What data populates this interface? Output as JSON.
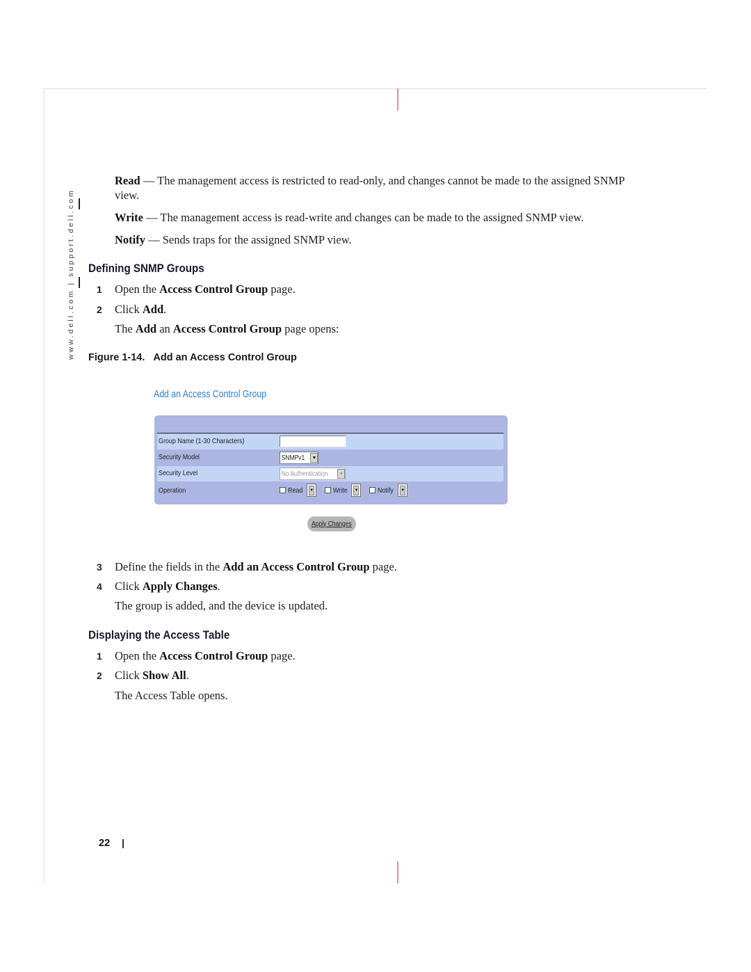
{
  "page": {
    "side_url": "www.dell.com | support.dell.com",
    "page_number": "22",
    "accent_crop_color": "#f08a8a"
  },
  "definitions": [
    {
      "term": "Read",
      "text": " — The management access is restricted to read-only, and changes cannot be made to the assigned SNMP view."
    },
    {
      "term": "Write",
      "text": " — The management access is read-write and changes can be made to the assigned SNMP view."
    },
    {
      "term": "Notify",
      "text": " — Sends traps for the assigned SNMP view."
    }
  ],
  "section1": {
    "heading": "Defining SNMP Groups",
    "steps": [
      {
        "num": "1",
        "pre": "Open the ",
        "bold": "Access Control Group",
        "post": " page."
      },
      {
        "num": "2",
        "pre": "Click ",
        "bold": "Add",
        "post": "."
      }
    ],
    "note": {
      "pre": "The ",
      "bold1": "Add",
      "mid": " an ",
      "bold2": "Access Control Group",
      "post": " page opens:"
    },
    "steps_after": [
      {
        "num": "3",
        "pre": "Define the fields in the ",
        "bold": "Add an Access Control Group",
        "post": " page."
      },
      {
        "num": "4",
        "pre": "Click ",
        "bold": "Apply Changes",
        "post": "."
      }
    ],
    "note_after": "The group is added, and the device is updated."
  },
  "figure": {
    "caption_num": "Figure 1-14.",
    "caption_title": "Add an Access Control Group",
    "screen_title": "Add an Access Control Group",
    "title_color": "#2a7fd4",
    "panel_color": "#adb6e3",
    "rows": {
      "group_name": {
        "label": "Group Name (1-30 Characters)",
        "value": ""
      },
      "security_model": {
        "label": "Security Model",
        "value": "SNMPv1"
      },
      "security_level": {
        "label": "Security Level",
        "value": "No Authentication"
      },
      "operation": {
        "label": "Operation",
        "options": [
          {
            "label": "Read",
            "checked": false
          },
          {
            "label": "Write",
            "checked": false
          },
          {
            "label": "Notify",
            "checked": false
          }
        ]
      }
    },
    "apply_button": "Apply Changes"
  },
  "section2": {
    "heading": "Displaying the Access Table",
    "steps": [
      {
        "num": "1",
        "pre": "Open the ",
        "bold": "Access Control Group",
        "post": " page."
      },
      {
        "num": "2",
        "pre": "Click ",
        "bold": "Show All",
        "post": "."
      }
    ],
    "note": "The Access Table opens."
  },
  "icons": {
    "dropdown_arrow": "▼"
  }
}
